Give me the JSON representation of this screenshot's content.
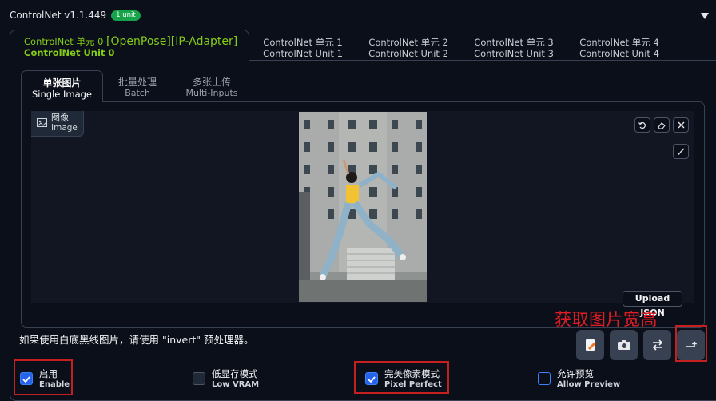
{
  "header": {
    "title": "ControlNet v1.1.449",
    "badge": "1 unit"
  },
  "unit_tabs": [
    {
      "line1_prefix": "ControlNet 单元 0",
      "line1_suffix": "[OpenPose][IP-Adapter]",
      "line2": "ControlNet Unit 0"
    },
    {
      "line1": "ControlNet 单元 1",
      "line2": "ControlNet Unit 1"
    },
    {
      "line1": "ControlNet 单元 2",
      "line2": "ControlNet Unit 2"
    },
    {
      "line1": "ControlNet 单元 3",
      "line2": "ControlNet Unit 3"
    },
    {
      "line1": "ControlNet 单元 4",
      "line2": "ControlNet Unit 4"
    }
  ],
  "sub_tabs": [
    {
      "zh": "单张图片",
      "en": "Single Image"
    },
    {
      "zh": "批量处理",
      "en": "Batch"
    },
    {
      "zh": "多张上传",
      "en": "Multi-Inputs"
    }
  ],
  "image_label": {
    "zh": "图像",
    "en": "Image"
  },
  "upload_json": "Upload JSON",
  "annotation": "获取图片宽高",
  "note": "如果使用白底黑线图片，请使用 \"invert\" 预处理器。",
  "options": [
    {
      "zh": "启用",
      "en": "Enable",
      "checked": true
    },
    {
      "zh": "低显存模式",
      "en": "Low VRAM",
      "checked": false
    },
    {
      "zh": "完美像素模式",
      "en": "Pixel Perfect",
      "checked": true
    },
    {
      "zh": "允许预览",
      "en": "Allow Preview",
      "checked": false
    }
  ],
  "icons": [
    "image-icon",
    "undo-icon",
    "eraser-icon",
    "close-icon",
    "brush-icon",
    "edit-icon",
    "camera-icon",
    "swap-icon",
    "send-dimensions-icon",
    "collapse-icon"
  ],
  "colors": {
    "accent_green": "#84cc16",
    "badge_green": "#16a34a",
    "checkbox_blue": "#2563eb",
    "annotation_red": "#e11d24"
  }
}
